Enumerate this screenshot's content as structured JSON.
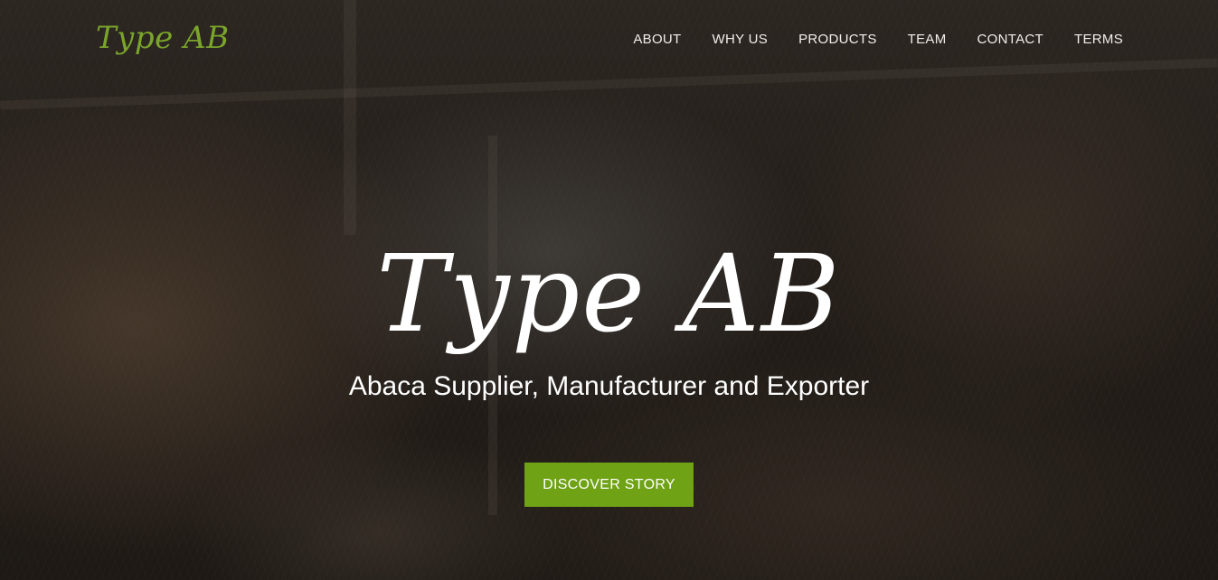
{
  "brand": {
    "logo_text": "Type AB",
    "accent_color": "#7aa52a"
  },
  "nav": {
    "items": [
      {
        "label": "ABOUT"
      },
      {
        "label": "WHY US"
      },
      {
        "label": "PRODUCTS"
      },
      {
        "label": "TEAM"
      },
      {
        "label": "CONTACT"
      },
      {
        "label": "TERMS"
      }
    ]
  },
  "hero": {
    "title": "Type AB",
    "subtitle": "Abaca Supplier, Manufacturer and Exporter",
    "cta_label": "DISCOVER STORY",
    "cta_color": "#6fa315"
  }
}
